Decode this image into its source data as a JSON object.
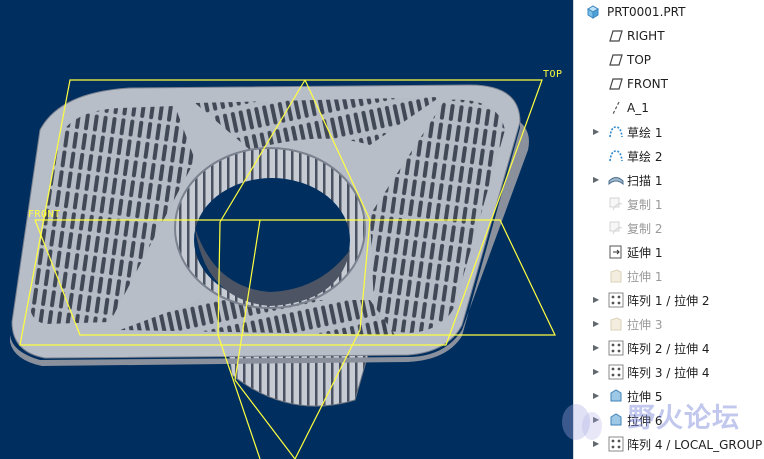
{
  "viewport": {
    "background": "#002f5f",
    "plane_color": "#ffff40",
    "labels": {
      "top": "TOP",
      "front": "FRONT"
    }
  },
  "tree": {
    "root": "PRT0001.PRT",
    "items": [
      {
        "label": "RIGHT",
        "icon": "datum-plane-icon",
        "expand": false,
        "dim": false
      },
      {
        "label": "TOP",
        "icon": "datum-plane-icon",
        "expand": false,
        "dim": false
      },
      {
        "label": "FRONT",
        "icon": "datum-plane-icon",
        "expand": false,
        "dim": false
      },
      {
        "label": "A_1",
        "icon": "datum-axis-icon",
        "expand": false,
        "dim": false
      },
      {
        "label": "草绘 1",
        "icon": "sketch-icon",
        "expand": true,
        "dim": false
      },
      {
        "label": "草绘 2",
        "icon": "sketch-icon",
        "expand": false,
        "dim": false
      },
      {
        "label": "扫描 1",
        "icon": "sweep-icon",
        "expand": true,
        "dim": false
      },
      {
        "label": "复制 1",
        "icon": "copy-icon",
        "expand": false,
        "dim": true
      },
      {
        "label": "复制 2",
        "icon": "copy-icon",
        "expand": false,
        "dim": true
      },
      {
        "label": "延伸 1",
        "icon": "extend-icon",
        "expand": false,
        "dim": false
      },
      {
        "label": "拉伸 1",
        "icon": "extrude-icon",
        "expand": false,
        "dim": true
      },
      {
        "label": "阵列 1 / 拉伸 2",
        "icon": "pattern-icon",
        "expand": true,
        "dim": false
      },
      {
        "label": "拉伸 3",
        "icon": "extrude-icon",
        "expand": true,
        "dim": true
      },
      {
        "label": "阵列 2 / 拉伸 4",
        "icon": "pattern-icon",
        "expand": true,
        "dim": false
      },
      {
        "label": "阵列 3 / 拉伸 4",
        "icon": "pattern-icon",
        "expand": true,
        "dim": false
      },
      {
        "label": "拉伸 5",
        "icon": "extrude-solid-icon",
        "expand": true,
        "dim": false
      },
      {
        "label": "拉伸 6",
        "icon": "extrude-solid-icon",
        "expand": true,
        "dim": false
      },
      {
        "label": "阵列 4 / LOCAL_GROUP",
        "icon": "pattern-icon",
        "expand": true,
        "dim": false
      }
    ]
  },
  "watermark": {
    "text": "野火论坛"
  }
}
